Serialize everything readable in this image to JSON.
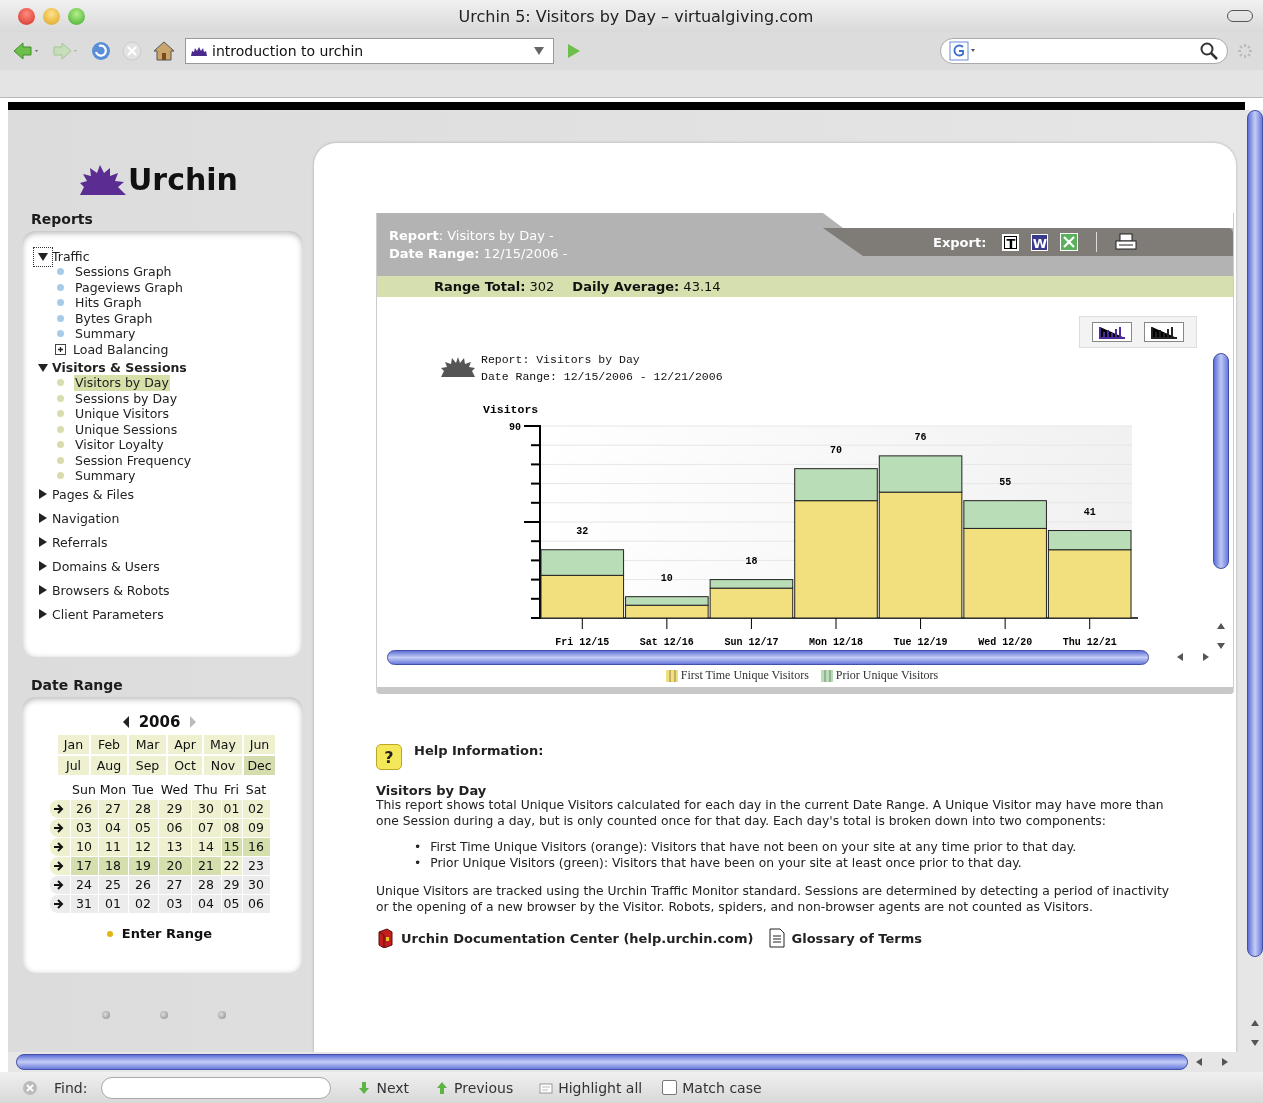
{
  "window": {
    "title": "Urchin 5: Visitors by Day – virtualgiving.com"
  },
  "toolbar": {
    "url": "introduction to urchin"
  },
  "sidebar": {
    "logo": "Urchin",
    "reports_heading": "Reports",
    "tree": [
      {
        "label": "Traffic",
        "expanded": true,
        "focused": true,
        "current": false,
        "color": "#a8cbe8",
        "children": [
          {
            "label": "Sessions Graph",
            "kind": "leaf",
            "selected": false
          },
          {
            "label": "Pageviews Graph",
            "kind": "leaf",
            "selected": false
          },
          {
            "label": "Hits Graph",
            "kind": "leaf",
            "selected": false
          },
          {
            "label": "Bytes Graph",
            "kind": "leaf",
            "selected": false
          },
          {
            "label": "Summary",
            "kind": "leaf",
            "selected": false
          },
          {
            "label": "Load Balancing",
            "kind": "subgroup",
            "selected": false
          }
        ]
      },
      {
        "label": "Visitors & Sessions",
        "expanded": true,
        "current": true,
        "color": "#d8dcae",
        "children": [
          {
            "label": "Visitors by Day",
            "kind": "leaf",
            "selected": true
          },
          {
            "label": "Sessions by Day",
            "kind": "leaf",
            "selected": false
          },
          {
            "label": "Unique Visitors",
            "kind": "leaf",
            "selected": false
          },
          {
            "label": "Unique Sessions",
            "kind": "leaf",
            "selected": false
          },
          {
            "label": "Visitor Loyalty",
            "kind": "leaf",
            "selected": false
          },
          {
            "label": "Session Frequency",
            "kind": "leaf",
            "selected": false
          },
          {
            "label": "Summary",
            "kind": "leaf",
            "selected": false
          }
        ]
      },
      {
        "label": "Pages & Files",
        "expanded": false,
        "current": false
      },
      {
        "label": "Navigation",
        "expanded": false,
        "current": false
      },
      {
        "label": "Referrals",
        "expanded": false,
        "current": false
      },
      {
        "label": "Domains & Users",
        "expanded": false,
        "current": false
      },
      {
        "label": "Browsers & Robots",
        "expanded": false,
        "current": false
      },
      {
        "label": "Client Parameters",
        "expanded": false,
        "current": false
      }
    ],
    "date_heading": "Date Range",
    "calendar": {
      "year": "2006",
      "months": [
        {
          "label": "Jan",
          "selected": false
        },
        {
          "label": "Feb",
          "selected": false
        },
        {
          "label": "Mar",
          "selected": false
        },
        {
          "label": "Apr",
          "selected": false
        },
        {
          "label": "May",
          "selected": false
        },
        {
          "label": "Jun",
          "selected": false
        },
        {
          "label": "Jul",
          "selected": false
        },
        {
          "label": "Aug",
          "selected": false
        },
        {
          "label": "Sep",
          "selected": false
        },
        {
          "label": "Oct",
          "selected": false
        },
        {
          "label": "Nov",
          "selected": false
        },
        {
          "label": "Dec",
          "selected": true
        }
      ],
      "weekdays": [
        "Sun",
        "Mon",
        "Tue",
        "Wed",
        "Thu",
        "Fri",
        "Sat"
      ],
      "weeks": [
        {
          "available": true,
          "days": [
            {
              "label": "26",
              "selected": false,
              "available": true
            },
            {
              "label": "27",
              "selected": false,
              "available": true
            },
            {
              "label": "28",
              "selected": false,
              "available": true
            },
            {
              "label": "29",
              "selected": false,
              "available": true
            },
            {
              "label": "30",
              "selected": false,
              "available": true
            },
            {
              "label": "01",
              "selected": false,
              "available": true
            },
            {
              "label": "02",
              "selected": false,
              "available": true
            }
          ]
        },
        {
          "available": true,
          "days": [
            {
              "label": "03",
              "selected": false,
              "available": true
            },
            {
              "label": "04",
              "selected": false,
              "available": true
            },
            {
              "label": "05",
              "selected": false,
              "available": true
            },
            {
              "label": "06",
              "selected": false,
              "available": true
            },
            {
              "label": "07",
              "selected": false,
              "available": true
            },
            {
              "label": "08",
              "selected": false,
              "available": true
            },
            {
              "label": "09",
              "selected": false,
              "available": true
            }
          ]
        },
        {
          "available": true,
          "days": [
            {
              "label": "10",
              "selected": false,
              "available": true
            },
            {
              "label": "11",
              "selected": false,
              "available": true
            },
            {
              "label": "12",
              "selected": false,
              "available": true
            },
            {
              "label": "13",
              "selected": false,
              "available": true
            },
            {
              "label": "14",
              "selected": false,
              "available": true
            },
            {
              "label": "15",
              "selected": true,
              "available": true
            },
            {
              "label": "16",
              "selected": true,
              "available": true
            }
          ]
        },
        {
          "available": true,
          "days": [
            {
              "label": "17",
              "selected": true,
              "available": true
            },
            {
              "label": "18",
              "selected": true,
              "available": true
            },
            {
              "label": "19",
              "selected": true,
              "available": true
            },
            {
              "label": "20",
              "selected": true,
              "available": true
            },
            {
              "label": "21",
              "selected": true,
              "available": true
            },
            {
              "label": "22",
              "selected": false,
              "available": true
            },
            {
              "label": "23",
              "selected": false,
              "available": false
            }
          ]
        },
        {
          "available": false,
          "days": [
            {
              "label": "24",
              "selected": false,
              "available": false
            },
            {
              "label": "25",
              "selected": false,
              "available": false
            },
            {
              "label": "26",
              "selected": false,
              "available": false
            },
            {
              "label": "27",
              "selected": false,
              "available": false
            },
            {
              "label": "28",
              "selected": false,
              "available": false
            },
            {
              "label": "29",
              "selected": false,
              "available": false
            },
            {
              "label": "30",
              "selected": false,
              "available": false
            }
          ]
        },
        {
          "available": false,
          "days": [
            {
              "label": "31",
              "selected": false,
              "available": false
            },
            {
              "label": "01",
              "selected": false,
              "available": false
            },
            {
              "label": "02",
              "selected": false,
              "available": false
            },
            {
              "label": "03",
              "selected": false,
              "available": false
            },
            {
              "label": "04",
              "selected": false,
              "available": false
            },
            {
              "label": "05",
              "selected": false,
              "available": false
            },
            {
              "label": "06",
              "selected": false,
              "available": false
            }
          ]
        }
      ],
      "enter_range": "Enter Range"
    }
  },
  "report": {
    "title": "**Report**: Visitors by Day -",
    "range": "**Date Range:** 12/15/2006 -",
    "export_label": "Export:",
    "export_formats": [
      "T",
      "W"
    ],
    "range_total": "**Range Total:** 302",
    "daily_average": "**Daily Average:** 43.14",
    "graph_title": "Report: Visitors by Day",
    "graph_range": "Date Range: 12/15/2006 - 12/21/2006",
    "chart_data": {
      "type": "bar",
      "stacked": true,
      "ylabel": "Visitors",
      "categories": [
        "Fri 12/15",
        "Sat 12/16",
        "Sun 12/17",
        "Mon 12/18",
        "Tue 12/19",
        "Wed 12/20",
        "Thu 12/21"
      ],
      "series": [
        {
          "name": "First Time Unique Visitors",
          "color": "#f2df7e",
          "values": [
            20,
            6,
            14,
            55,
            59,
            42,
            32
          ]
        },
        {
          "name": "Prior Unique Visitors",
          "color": "#b9ddb6",
          "values": [
            12,
            4,
            4,
            15,
            17,
            13,
            9
          ]
        }
      ],
      "ylim": [
        0,
        90
      ],
      "yticks": [
        90
      ],
      "value_labels": [
        "32",
        "10",
        "18",
        "70",
        "76",
        "55",
        "41"
      ]
    }
  },
  "help": {
    "icon": "?",
    "heading": "Help Information:",
    "title": "Visitors by Day",
    "intro": "This report shows total Unique Visitors calculated for each day in the current Date Range. A Unique Visitor may have more than one Session during a day, but is only counted once for that day. Each day's total is broken down into two components:",
    "bullets": [
      {
        "marker": "•",
        "text": "First Time Unique Visitors (orange): Visitors that have not been on your site at any time prior to that day."
      },
      {
        "marker": "•",
        "text": "Prior Unique Visitors (green): Visitors that have been on your site at least once prior to that day."
      }
    ],
    "note": "Unique Visitors are tracked using the Urchin Traffic Monitor standard. Sessions are determined by detecting a period of inactivity or the opening of a new browser by the Visitor. Robots, spiders, and non-browser agents are not counted as Visitors.",
    "links": [
      {
        "label": "Urchin Documentation Center (help.urchin.com)",
        "kind": "book"
      },
      {
        "label": "Glossary of Terms",
        "kind": "document"
      }
    ]
  },
  "find_bar": {
    "label": "Find:",
    "next": "Next",
    "previous": "Previous",
    "highlight": "Highlight all",
    "match_case": {
      "label": "Match case",
      "checked": false
    }
  }
}
